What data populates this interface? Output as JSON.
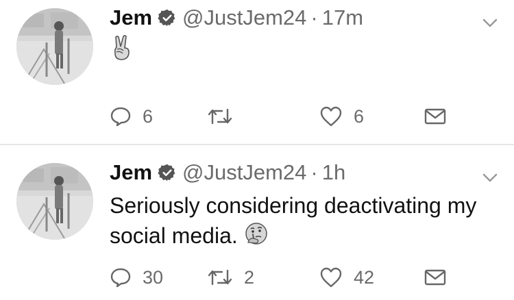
{
  "tweets": [
    {
      "name": "Jem",
      "handle": "@JustJem24",
      "separator": "·",
      "time": "17m",
      "text": "✌️",
      "replies": "6",
      "retweets": "",
      "likes": "6"
    },
    {
      "name": "Jem",
      "handle": "@JustJem24",
      "separator": "·",
      "time": "1h",
      "text": "Seriously considering deactivating my social media.",
      "emoji": "thinking-face",
      "replies": "30",
      "retweets": "2",
      "likes": "42"
    }
  ],
  "icons": {
    "reply": "reply-icon",
    "retweet": "retweet-icon",
    "like": "heart-icon",
    "dm": "envelope-icon",
    "verified": "verified-badge-icon",
    "more": "chevron-down-icon"
  },
  "colors": {
    "text": "#111111",
    "muted": "#6a6a6a",
    "divider": "#e6e6e6"
  }
}
